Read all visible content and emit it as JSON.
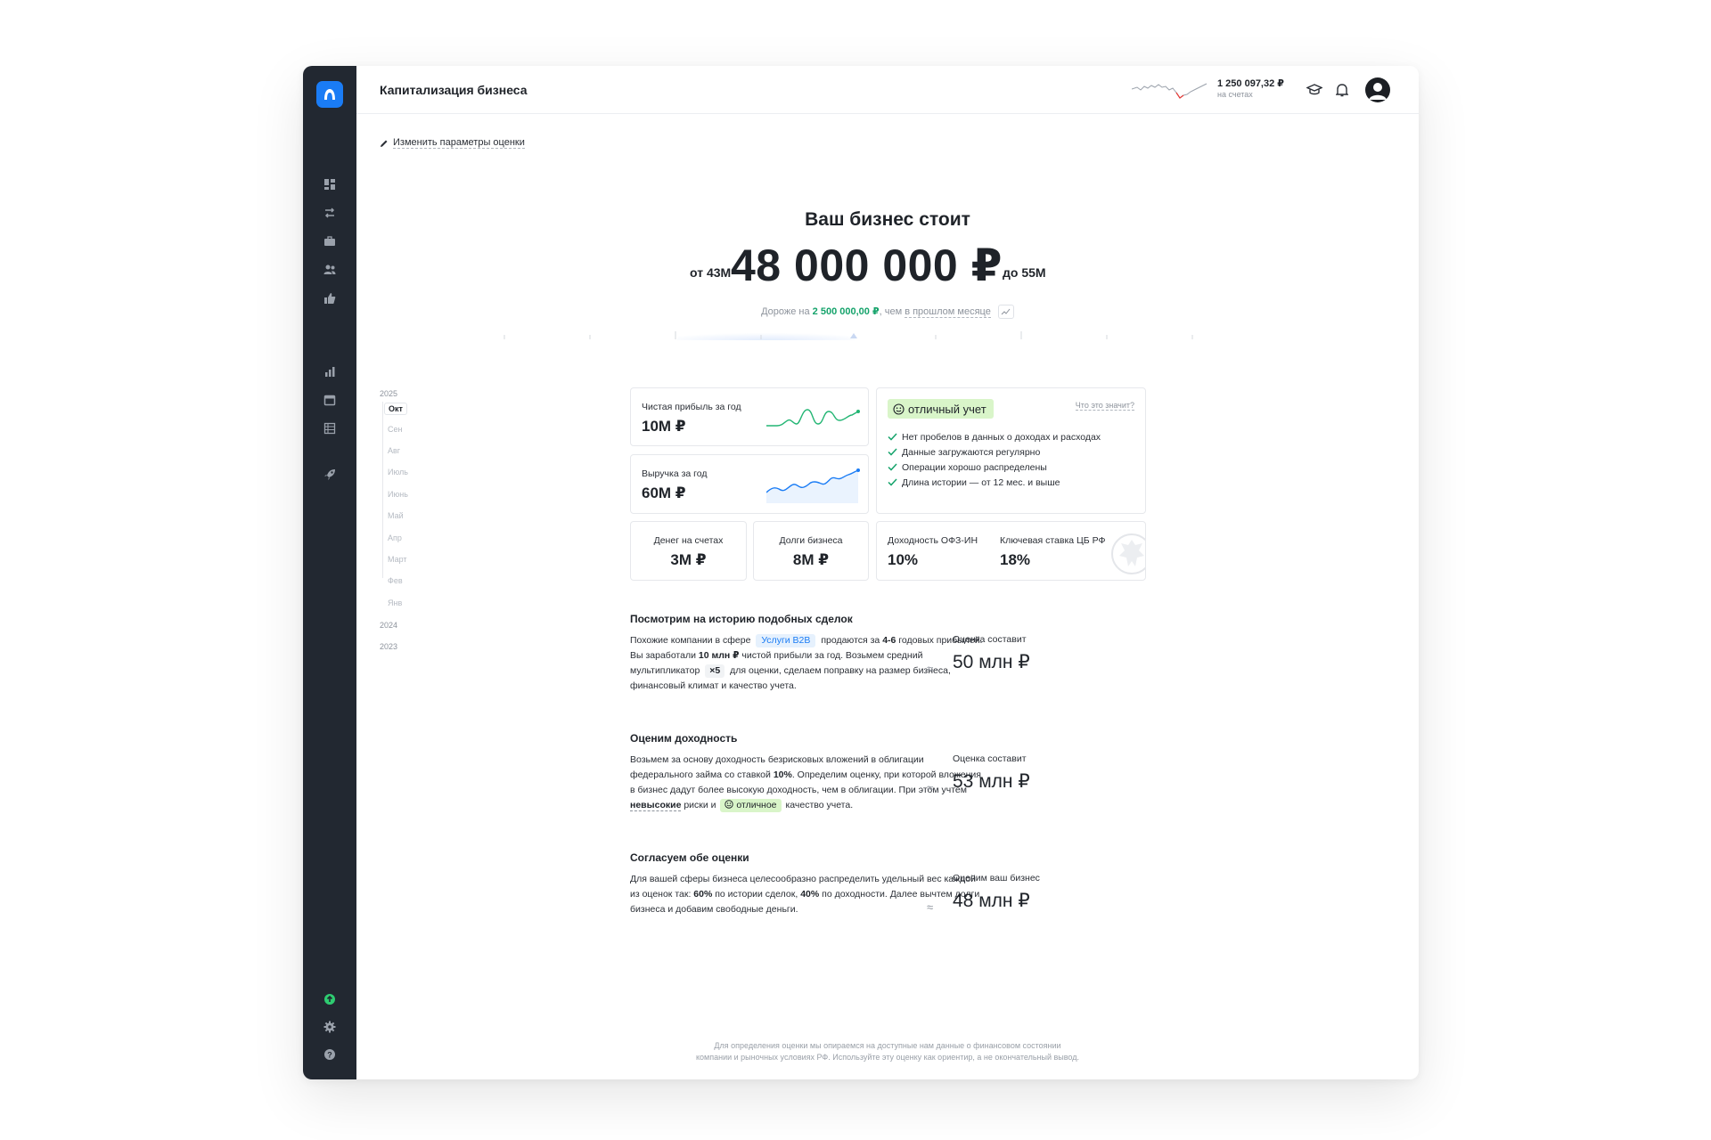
{
  "header": {
    "title": "Капитализация бизнеса",
    "balance": "1 250 097,32 ₽",
    "balance_caption": "на счетах"
  },
  "sidebar": {
    "items": [
      {
        "name": "dashboard-icon"
      },
      {
        "name": "transfers-icon"
      },
      {
        "name": "briefcase-icon"
      },
      {
        "name": "people-icon"
      },
      {
        "name": "thumbs-up-icon"
      },
      {
        "name": "bar-chart-icon"
      },
      {
        "name": "calendar-icon"
      },
      {
        "name": "table-icon"
      },
      {
        "name": "rocket-icon"
      }
    ],
    "bottom": [
      {
        "name": "upgrade-icon"
      },
      {
        "name": "gear-icon"
      },
      {
        "name": "help-icon"
      }
    ]
  },
  "edit_params": "Изменить параметры оценки",
  "hero": {
    "label": "Ваш бизнес стоит",
    "from": "от 43М",
    "amount": "48 000 000 ₽",
    "to": "до 55М",
    "delta_prefix": "Дороже на",
    "delta_value": "2 500 000,00 ₽",
    "delta_mid": ", чем",
    "delta_link": "в прошлом месяце"
  },
  "timeline": {
    "years": [
      "2025",
      "2024",
      "2023"
    ],
    "months": [
      "Окт",
      "Сен",
      "Авг",
      "Июль",
      "Июнь",
      "Май",
      "Апр",
      "Март",
      "Фев",
      "Янв"
    ],
    "active_month": "Окт"
  },
  "metrics": {
    "net_profit_label": "Чистая прибыль за год",
    "net_profit_value": "10М ₽",
    "revenue_label": "Выручка за год",
    "revenue_value": "60М ₽",
    "cash_label": "Денег на счетах",
    "cash_value": "3М ₽",
    "debt_label": "Долги бизнеса",
    "debt_value": "8М ₽",
    "ofz_label": "Доходность ОФЗ-ИН",
    "ofz_value": "10%",
    "key_rate_label": "Ключевая ставка ЦБ РФ",
    "key_rate_value": "18%"
  },
  "quality": {
    "badge": "отличный учет",
    "what_link": "Что это значит?",
    "checks": [
      "Нет пробелов в данных о доходах и расходах",
      "Данные загружаются регулярно",
      "Операции хорошо распределены",
      "Длина истории — от 12 мес. и выше"
    ]
  },
  "sections": {
    "deals": {
      "title": "Посмотрим на историю подобных сделок",
      "t1": "Похожие компании в сфере",
      "tag": "Услуги B2B",
      "t2": "продаются за",
      "b1": "4-6",
      "t3": "годовых прибылей. Вы заработали",
      "b2": "10 млн ₽",
      "t4": "чистой прибыли за год. Возьмем средний мультипликатор",
      "mult": "×5",
      "t5": "для оценки, сделаем поправку на размер бизнеса, финансовый климат и качество учета.",
      "est_label": "Оценка составит",
      "est_value": "50 млн ₽"
    },
    "yield": {
      "title": "Оценим доходность",
      "t1": "Возьмем за основу доходность безрисковых вложений в облигации федерального займа со ставкой",
      "b1": "10%",
      "t2": ". Определим оценку, при которой вложения в бизнес дадут более высокую доходность, чем в облигации. При этом учтем",
      "risk": "невысокие",
      "t3": "риски и",
      "tag": "отличное",
      "t4": "качество учета.",
      "est_label": "Оценка составит",
      "est_value": "53 млн ₽"
    },
    "combine": {
      "title": "Согласуем обе оценки",
      "t1": "Для вашей сферы бизнеса целесообразно распределить удельный вес каждой из оценок так:",
      "b1": "60%",
      "t2": "по истории сделок,",
      "b2": "40%",
      "t3": "по доходности. Далее вычтем долги бизнеса и добавим свободные деньги.",
      "est_label": "Оценим ваш бизнес",
      "est_value": "48 млн ₽"
    },
    "approx": "≈"
  },
  "footer": {
    "line1": "Для определения оценки мы опираемся на доступные нам данные о финансовом состоянии",
    "line2": "компании и рыночных условиях РФ. Используйте эту оценку как ориентир, а не окончательный вывод."
  },
  "colors": {
    "sidebar_bg": "#222831",
    "accent_blue": "#1a7cf5",
    "accent_green": "#15a36b",
    "badge_green": "#d9f5c9"
  }
}
